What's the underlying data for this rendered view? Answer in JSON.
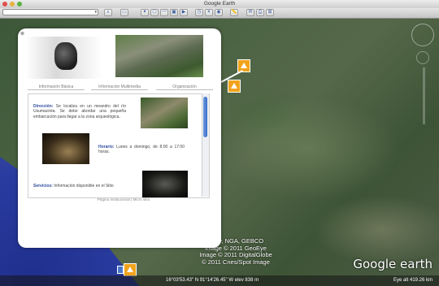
{
  "window": {
    "title": "Google Earth"
  },
  "toolbar": {
    "search_placeholder": ""
  },
  "popup": {
    "tabs": [
      "Información Básica",
      "Información Multimedia",
      "Organización"
    ],
    "direccion_label": "Dirección:",
    "direccion_text": "Se localiza en un meandro del río Usumacinta. Se debe abordar una pequeña embarcación para llegar a la zona arqueológica.",
    "horario_label": "Horario:",
    "horario_text": "Lunes a domingo, de 8:00 a 17:00 horas.",
    "servicios_label": "Servicios:",
    "servicios_text": "Información disponible en el Sitio",
    "footer": "Página Institucional | Micro sitio"
  },
  "map": {
    "credits": [
      "Navy, NGA, GEBCO",
      "Image © 2011 GeoEye",
      "Image © 2011 DigitalGlobe",
      "© 2011 Cnes/Spot Image"
    ],
    "logo": "Google earth"
  },
  "status": {
    "coords": "16°03'53.43\" N  91°14'26.45\" W  elev  838 m",
    "eye_alt": "Eye alt  419.26 km"
  }
}
